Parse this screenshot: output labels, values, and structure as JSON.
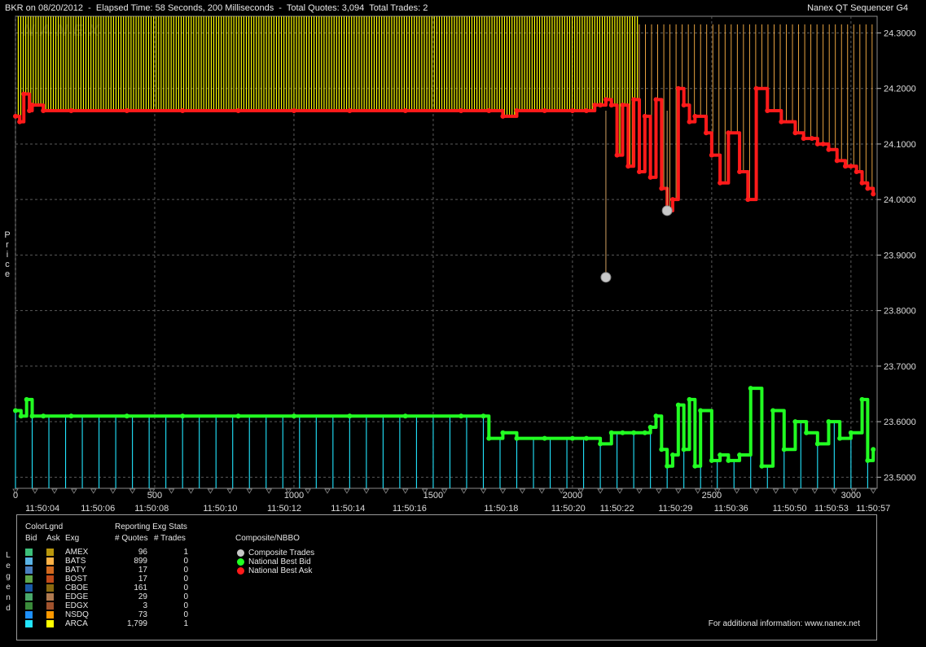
{
  "header": {
    "left": "BKR on 08/20/2012  -  Elapsed Time: 58 Seconds, 200 Milliseconds  -  Total Quotes: 3,094  Total Trades: 2",
    "right": "Nanex QT Sequencer G4"
  },
  "watermark": "NANEX",
  "yaxis_title": "Price",
  "legend_side_title": "Legend",
  "colors": {
    "background": "#000000",
    "grid": "#5a5a5a",
    "ask_bbo": "#ff1a1a",
    "bid_bbo": "#22ff22",
    "trade": "#c8c8c8",
    "arca_ask": "#ffff00",
    "arca_bid": "#22e6ff",
    "bats_ask": "#ffb347"
  },
  "chart_data": {
    "type": "line",
    "title": "BKR on 08/20/2012",
    "xlabel": "",
    "ylabel": "Price",
    "ylim": [
      23.48,
      24.33
    ],
    "xlim": [
      0,
      3094
    ],
    "y_ticks": [
      "24.3000",
      "24.2000",
      "24.1000",
      "24.0000",
      "23.9000",
      "23.8000",
      "23.7000",
      "23.6000",
      "23.5000"
    ],
    "x_seq_ticks": [
      "0",
      "500",
      "1000",
      "1500",
      "2000",
      "2500",
      "3000"
    ],
    "x_time_labels": [
      "11:50:04",
      "11:50:06",
      "11:50:08",
      "11:50:10",
      "11:50:12",
      "11:50:14",
      "11:50:16",
      "11:50:18",
      "11:50:20",
      "11:50:22",
      "11:50:29",
      "11:50:36",
      "11:50:50",
      "11:50:53",
      "11:50:57"
    ],
    "x_time_positions": [
      97,
      296,
      489,
      735,
      965,
      1194,
      1415,
      1744,
      1985,
      2160,
      2370,
      2570,
      2780,
      2930,
      3080
    ],
    "series": [
      {
        "name": "National Best Ask",
        "x": [
          0,
          15,
          30,
          50,
          60,
          100,
          200,
          400,
          600,
          800,
          1000,
          1200,
          1400,
          1600,
          1700,
          1750,
          1800,
          1900,
          2000,
          2050,
          2080,
          2100,
          2120,
          2140,
          2160,
          2180,
          2200,
          2220,
          2240,
          2260,
          2280,
          2300,
          2320,
          2340,
          2360,
          2380,
          2400,
          2420,
          2440,
          2480,
          2500,
          2530,
          2560,
          2600,
          2630,
          2660,
          2700,
          2750,
          2800,
          2830,
          2860,
          2880,
          2900,
          2920,
          2950,
          2980,
          3000,
          3020,
          3040,
          3060,
          3080
        ],
        "values": [
          24.15,
          24.14,
          24.19,
          24.16,
          24.17,
          24.16,
          24.16,
          24.16,
          24.16,
          24.16,
          24.16,
          24.16,
          24.16,
          24.16,
          24.16,
          24.15,
          24.16,
          24.16,
          24.16,
          24.16,
          24.17,
          24.17,
          24.18,
          24.17,
          24.08,
          24.17,
          24.06,
          24.18,
          24.05,
          24.15,
          24.04,
          24.18,
          24.02,
          23.98,
          24.0,
          24.2,
          24.17,
          24.14,
          24.15,
          24.12,
          24.08,
          24.03,
          24.12,
          24.05,
          24.0,
          24.2,
          24.16,
          24.14,
          24.12,
          24.11,
          24.11,
          24.1,
          24.1,
          24.09,
          24.07,
          24.06,
          24.06,
          24.05,
          24.03,
          24.02,
          24.01
        ]
      },
      {
        "name": "National Best Bid",
        "x": [
          0,
          20,
          40,
          60,
          100,
          200,
          400,
          600,
          800,
          1000,
          1200,
          1400,
          1600,
          1680,
          1700,
          1750,
          1800,
          1900,
          2000,
          2050,
          2100,
          2140,
          2180,
          2220,
          2260,
          2280,
          2300,
          2320,
          2340,
          2360,
          2380,
          2400,
          2420,
          2440,
          2460,
          2500,
          2530,
          2560,
          2600,
          2640,
          2680,
          2720,
          2760,
          2800,
          2840,
          2880,
          2920,
          2960,
          3000,
          3040,
          3060,
          3080
        ],
        "values": [
          23.62,
          23.61,
          23.64,
          23.61,
          23.61,
          23.61,
          23.61,
          23.61,
          23.61,
          23.61,
          23.61,
          23.61,
          23.61,
          23.61,
          23.57,
          23.58,
          23.57,
          23.57,
          23.57,
          23.57,
          23.56,
          23.58,
          23.58,
          23.58,
          23.58,
          23.59,
          23.61,
          23.55,
          23.52,
          23.54,
          23.63,
          23.55,
          23.64,
          23.52,
          23.62,
          23.53,
          23.54,
          23.53,
          23.54,
          23.66,
          23.52,
          23.62,
          23.55,
          23.6,
          23.58,
          23.56,
          23.6,
          23.57,
          23.58,
          23.64,
          23.53,
          23.55
        ]
      },
      {
        "name": "Composite Trades",
        "x": [
          2120,
          2340
        ],
        "values": [
          23.86,
          23.98
        ]
      }
    ]
  },
  "legend": {
    "colorlgnd_label": "ColorLgnd",
    "reporting_label": "Reporting Exg Stats",
    "bid_label": "Bid",
    "ask_label": "Ask",
    "exg_label": "Exg",
    "quotes_label": "# Quotes",
    "trades_label": "# Trades",
    "composite_label": "Composite/NBBO",
    "rows": [
      {
        "exg": "AMEX",
        "quotes": "96",
        "trades": "1",
        "bid_color": "#3cbf7a",
        "ask_color": "#b8960c"
      },
      {
        "exg": "BATS",
        "quotes": "899",
        "trades": "0",
        "bid_color": "#5ab4e6",
        "ask_color": "#ffb347"
      },
      {
        "exg": "BATY",
        "quotes": "17",
        "trades": "0",
        "bid_color": "#4a7fc0",
        "ask_color": "#d2691e"
      },
      {
        "exg": "BOST",
        "quotes": "17",
        "trades": "0",
        "bid_color": "#5fa84a",
        "ask_color": "#c04a1a"
      },
      {
        "exg": "CBOE",
        "quotes": "161",
        "trades": "0",
        "bid_color": "#1a5aa8",
        "ask_color": "#8a6a10"
      },
      {
        "exg": "EDGE",
        "quotes": "29",
        "trades": "0",
        "bid_color": "#4aa86a",
        "ask_color": "#b07a50"
      },
      {
        "exg": "EDGX",
        "quotes": "3",
        "trades": "0",
        "bid_color": "#3a8a3a",
        "ask_color": "#a0522d"
      },
      {
        "exg": "NSDQ",
        "quotes": "73",
        "trades": "0",
        "bid_color": "#1e90ff",
        "ask_color": "#ff9900"
      },
      {
        "exg": "ARCA",
        "quotes": "1,799",
        "trades": "1",
        "bid_color": "#22e6ff",
        "ask_color": "#ffff00"
      }
    ],
    "composite": [
      {
        "label": "Composite Trades",
        "color": "#c8c8c8"
      },
      {
        "label": "National Best Bid",
        "color": "#22ff22"
      },
      {
        "label": "National Best Ask",
        "color": "#ff1a1a"
      }
    ],
    "footer": "For additional information: www.nanex.net"
  }
}
